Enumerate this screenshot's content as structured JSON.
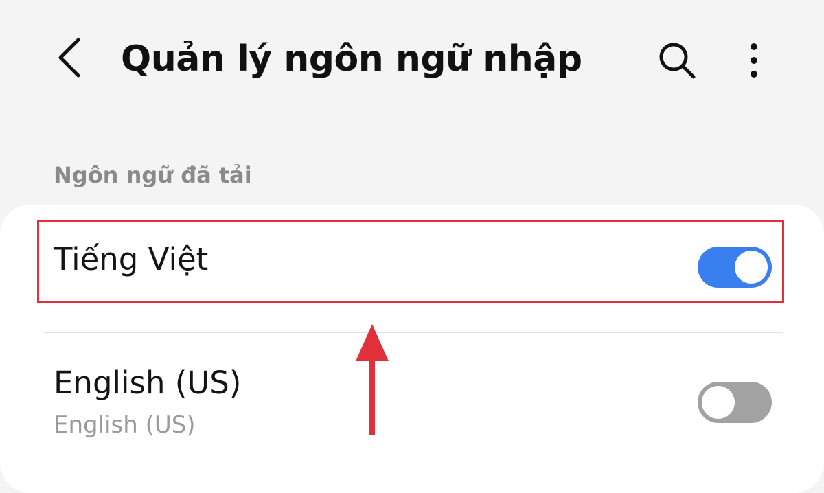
{
  "header": {
    "title": "Quản lý ngôn ngữ nhập"
  },
  "section": {
    "title": "Ngôn ngữ đã tải"
  },
  "languages": [
    {
      "label": "Tiếng Việt",
      "enabled": true
    },
    {
      "label": "English (US)",
      "sublabel": "English (US)",
      "enabled": false
    }
  ],
  "icons": {
    "back": "back-chevron-icon",
    "search": "search-icon",
    "more": "more-vertical-icon"
  },
  "colors": {
    "background": "#f4f4f4",
    "card": "#ffffff",
    "toggle_on": "#3a7ff0",
    "toggle_off": "#a2a2a2",
    "annotation": "#e0303a"
  }
}
